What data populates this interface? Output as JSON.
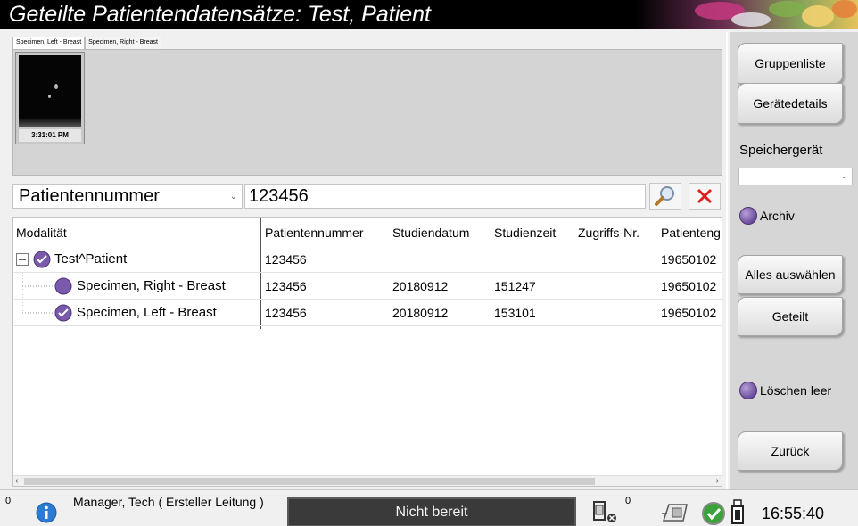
{
  "window": {
    "title": "Geteilte Patientendatensätze: Test, Patient"
  },
  "thumbnails": {
    "tabs": [
      "Specimen, Left - Breast",
      "Specimen, Right - Breast"
    ],
    "items": [
      {
        "time": "3:31:01 PM"
      }
    ]
  },
  "search": {
    "field": "Patientennummer",
    "value": "123456",
    "search_icon": "magnifier-icon",
    "clear_icon": "close-icon"
  },
  "table": {
    "columns": [
      "Modalität",
      "Patientennummer",
      "Studiendatum",
      "Studienzeit",
      "Zugriffs-Nr.",
      "Patienteng"
    ],
    "rows": [
      {
        "label": "Test^Patient",
        "patient_id": "123456",
        "date": "",
        "time": "",
        "accession": "",
        "dob": "19650102"
      },
      {
        "label": "Specimen, Right - Breast",
        "patient_id": "123456",
        "date": "20180912",
        "time": "151247",
        "accession": "",
        "dob": "19650102"
      },
      {
        "label": "Specimen, Left - Breast",
        "patient_id": "123456",
        "date": "20180912",
        "time": "153101",
        "accession": "",
        "dob": "19650102"
      }
    ]
  },
  "sidebar": {
    "group_list": "Gruppenliste",
    "device_details": "Gerätedetails",
    "storage_label": "Speichergerät",
    "storage_value": "",
    "archive": "Archiv",
    "select_all": "Alles auswählen",
    "split": "Geteilt",
    "delete_empty": "Löschen leer",
    "back": "Zurück"
  },
  "statusbar": {
    "count_left": "0",
    "user": "Manager, Tech ( Ersteller Leitung )",
    "state": "Nicht bereit",
    "count_right": "0",
    "clock": "16:55:40"
  },
  "colors": {
    "accent_purple": "#6a4c9c",
    "title_bg": "#000000",
    "danger_red": "#e02020"
  }
}
